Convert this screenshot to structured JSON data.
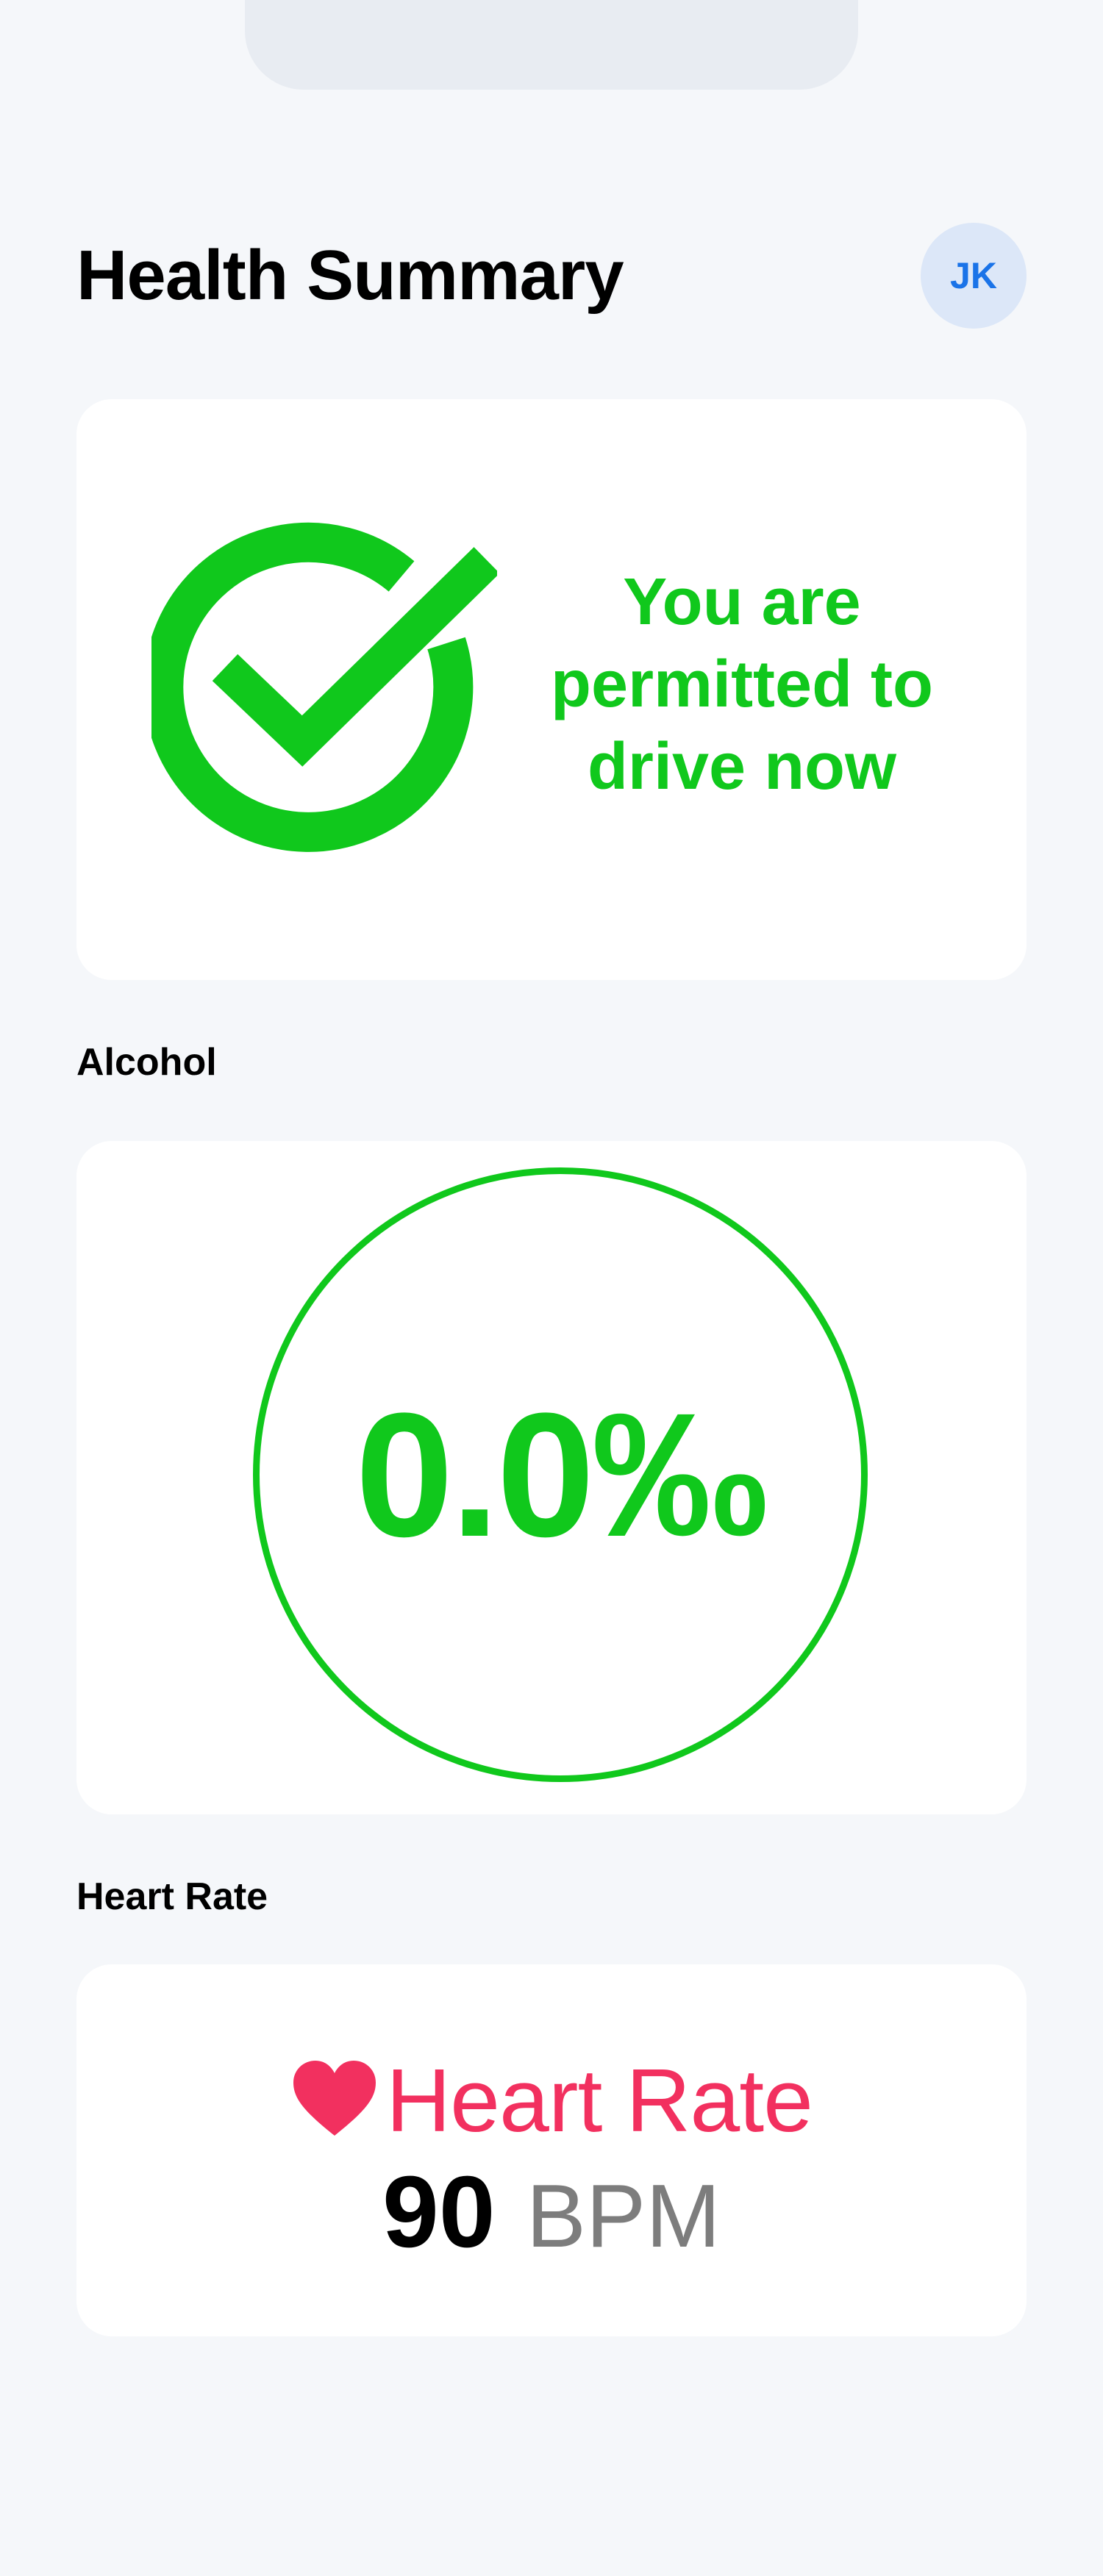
{
  "header": {
    "title": "Health Summary",
    "avatar_initials": "JK"
  },
  "status": {
    "icon": "check-circle-icon",
    "message": "You are permitted to drive now",
    "color": "#10c81c"
  },
  "alcohol": {
    "section_label": "Alcohol",
    "value": "0.0‰",
    "color": "#10c81c"
  },
  "heart_rate": {
    "section_label": "Heart Rate",
    "icon": "heart-icon",
    "title": "Heart Rate",
    "value": "90",
    "unit": "BPM",
    "color": "#f2305f"
  }
}
